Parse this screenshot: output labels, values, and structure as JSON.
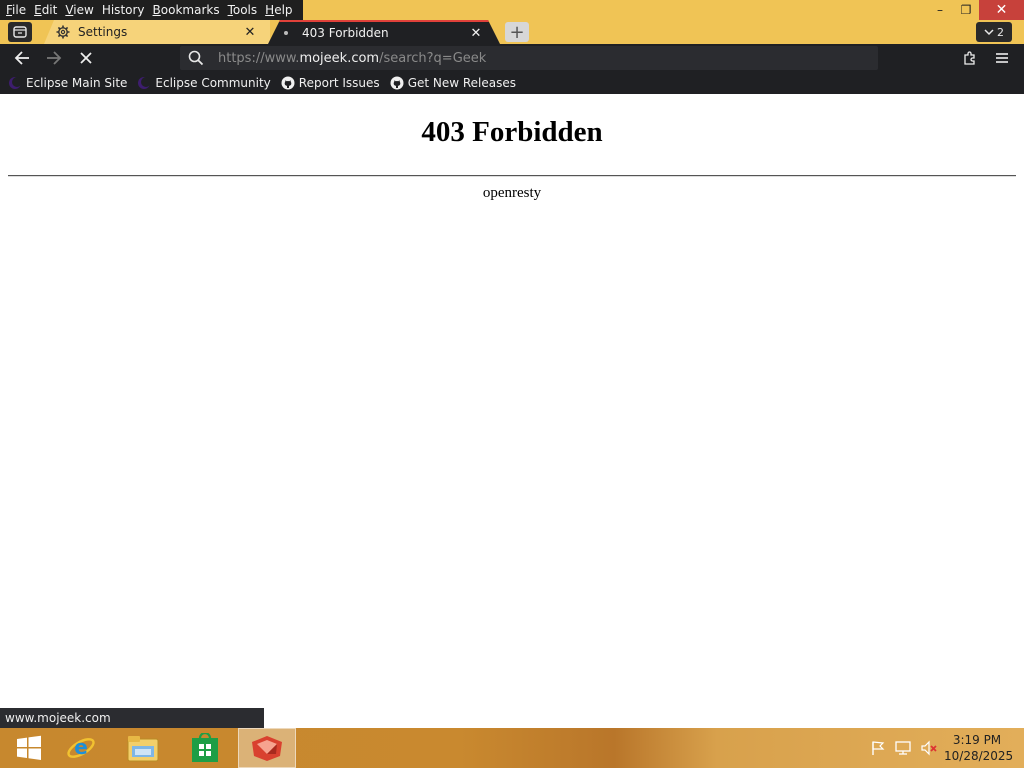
{
  "menu": {
    "items": [
      {
        "accel": "F",
        "rest": "ile"
      },
      {
        "accel": "E",
        "rest": "dit"
      },
      {
        "accel": "V",
        "rest": "iew"
      },
      {
        "accel": "",
        "rest": "History",
        "accel_mid": "H"
      },
      {
        "accel": "B",
        "rest": "ookmarks"
      },
      {
        "accel": "T",
        "rest": "ools"
      },
      {
        "accel": "H",
        "rest": "elp"
      }
    ]
  },
  "window_controls": {
    "minimize": "–",
    "restore": "❐",
    "close": "✕"
  },
  "tabs": {
    "settings": {
      "title": "Settings",
      "close": "✕"
    },
    "active": {
      "title": "403 Forbidden",
      "close": "✕"
    },
    "new_tab": "+",
    "tab_count": "2"
  },
  "urlbar": {
    "prefix": "https://www.",
    "domain": "mojeek.com",
    "suffix": "/search?q=Geek"
  },
  "bookmarks": [
    {
      "label": "Eclipse Main Site",
      "icon": "eclipse-icon"
    },
    {
      "label": "Eclipse Community",
      "icon": "eclipse-icon"
    },
    {
      "label": "Report Issues",
      "icon": "github-icon"
    },
    {
      "label": "Get New Releases",
      "icon": "github-icon"
    }
  ],
  "page": {
    "heading": "403 Forbidden",
    "server": "openresty"
  },
  "status_link": "www.mojeek.com",
  "clock": {
    "time": "3:19 PM",
    "date": "10/28/2025"
  },
  "colors": {
    "accent_yellow": "#f0c455",
    "dark_chrome": "#1f2023",
    "close_red": "#c7413b",
    "tab_active_top": "#e0413a"
  }
}
